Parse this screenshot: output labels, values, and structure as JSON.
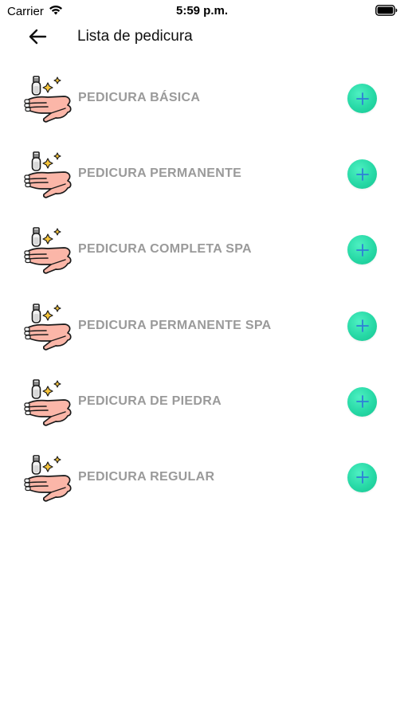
{
  "status_bar": {
    "carrier": "Carrier",
    "time": "5:59 p.m."
  },
  "nav": {
    "title": "Lista de pedicura",
    "back_icon": "arrow-left-icon"
  },
  "colors": {
    "add_button": "#27d9a6",
    "add_plus": "#2e7fd6",
    "item_text": "#9a9a9a"
  },
  "items": [
    {
      "label": "PEDICURA BÁSICA",
      "icon": "manicure-hand-icon"
    },
    {
      "label": "PEDICURA PERMANENTE",
      "icon": "manicure-hand-icon"
    },
    {
      "label": "PEDICURA COMPLETA SPA",
      "icon": "manicure-hand-icon"
    },
    {
      "label": "PEDICURA PERMANENTE SPA",
      "icon": "manicure-hand-icon"
    },
    {
      "label": "PEDICURA DE PIEDRA",
      "icon": "manicure-hand-icon"
    },
    {
      "label": "PEDICURA REGULAR",
      "icon": "manicure-hand-icon"
    }
  ]
}
